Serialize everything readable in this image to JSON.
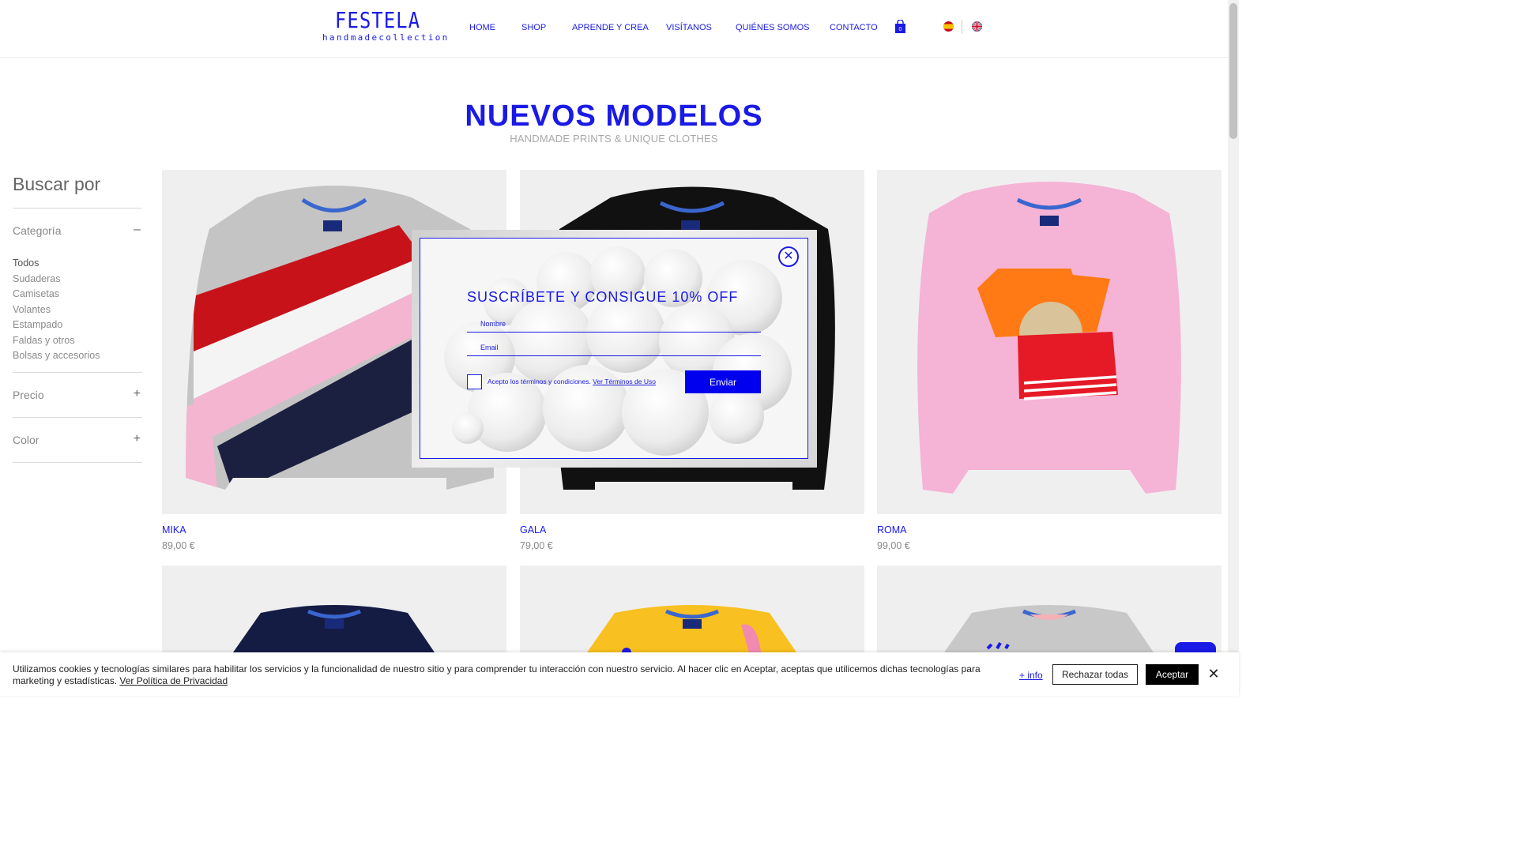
{
  "header": {
    "logo_main": "FESTELA",
    "logo_sub": "handmadecollection",
    "nav": [
      "HOME",
      "SHOP",
      "APRENDE Y CREA",
      "VISÍTANOS",
      "QUIÉNES SOMOS",
      "CONTACTO"
    ],
    "cart_count": "0",
    "languages": [
      "es-flag-icon",
      "uk-flag-icon"
    ]
  },
  "hero": {
    "title": "NUEVOS MODELOS",
    "subtitle": "HANDMADE PRINTS & UNIQUE CLOTHES"
  },
  "sidebar": {
    "title": "Buscar por",
    "category_label": "Categoría",
    "category_toggle": "–",
    "categories": [
      "Todos",
      "Sudaderas",
      "Camisetas",
      "Volantes",
      "Estampado",
      "Faldas y otros",
      "Bolsas y accesorios"
    ],
    "price_label": "Precio",
    "color_label": "Color",
    "expand_toggle": "+"
  },
  "products": [
    {
      "name": "MIKA",
      "price": "89,00 €"
    },
    {
      "name": "GALA",
      "price": "79,00 €"
    },
    {
      "name": "ROMA",
      "price": "99,00 €"
    }
  ],
  "popup": {
    "title": "SUSCRÍBETE Y CONSIGUE 10% OFF",
    "name_placeholder": "Nombre",
    "email_placeholder": "Email",
    "terms_text": "Acepto los términos y condiciones.",
    "terms_link": "Ver Términos de Uso",
    "submit_label": "Enviar",
    "close_label": "✕"
  },
  "cookie": {
    "text": "Utilizamos cookies y tecnologías similares para habilitar los servicios y la funcionalidad de nuestro sitio y para comprender tu interacción con nuestro servicio. Al hacer clic en Aceptar, aceptas que utilicemos dichas tecnologías para marketing y estadísticas.",
    "policy_link": "Ver Política de Privacidad",
    "info_link": "+ info",
    "reject_label": "Rechazar todas",
    "accept_label": "Aceptar",
    "close_label": "✕"
  },
  "colors": {
    "brand": "#1a1ae6",
    "button_blue": "#0000ee"
  }
}
